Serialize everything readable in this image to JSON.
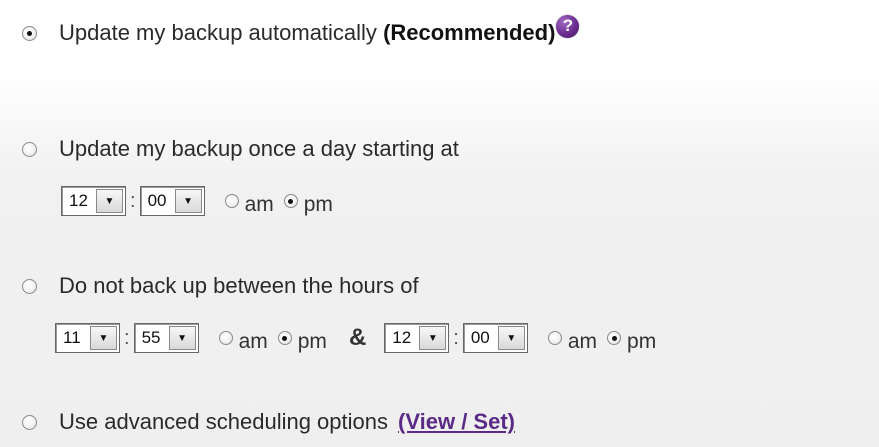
{
  "options": {
    "automatic": {
      "label": "Update my backup automatically",
      "note": "(Recommended)",
      "checked": true
    },
    "daily": {
      "label": "Update my backup once a day starting at",
      "checked": false
    },
    "blackout": {
      "label": "Do not back up between the hours of",
      "checked": false
    },
    "advanced": {
      "label": "Use advanced scheduling options",
      "link": "(View / Set)",
      "checked": false
    }
  },
  "help_icon": {
    "icon": "question-mark-icon",
    "glyph": "?",
    "color": "#6a2d8e"
  },
  "daily_time": {
    "hour": "12",
    "minute": "00",
    "am_label": "am",
    "pm_label": "pm",
    "selected": "pm"
  },
  "blackout_start": {
    "hour": "11",
    "minute": "55",
    "am_label": "am",
    "pm_label": "pm",
    "selected": "pm"
  },
  "blackout_end": {
    "hour": "12",
    "minute": "00",
    "am_label": "am",
    "pm_label": "pm",
    "selected": "pm"
  },
  "separators": {
    "colon": ":",
    "ampersand": "&"
  },
  "colors": {
    "link": "#5b2a86",
    "text": "#2a2a2a"
  }
}
